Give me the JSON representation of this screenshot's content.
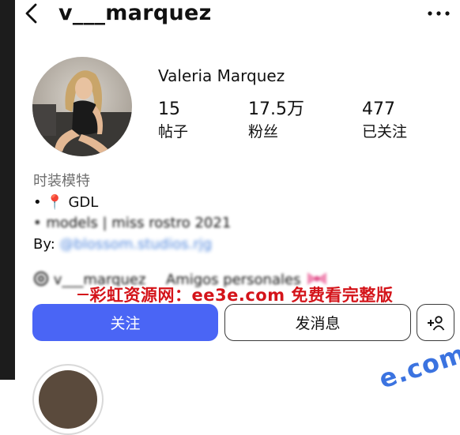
{
  "header": {
    "username": "v___marquez"
  },
  "profile": {
    "display_name": "Valeria Marquez",
    "stats": [
      {
        "value": "15",
        "label": "帖子"
      },
      {
        "value": "17.5万",
        "label": "粉丝"
      },
      {
        "value": "477",
        "label": "已关注"
      }
    ]
  },
  "bio": {
    "category": "时装模特",
    "line1": "• 📍 GDL",
    "line2": "• models | miss rostro 2021",
    "line3_prefix": "By: ",
    "line3_handle": "@blossom.studios.rjg"
  },
  "links": {
    "threads_handle": "v___marquez",
    "close_friends": "Amigos personales"
  },
  "watermark": {
    "text": "彩虹资源网：ee3e.com 免费看完整版",
    "corner": "e.com"
  },
  "actions": {
    "follow_label": "关注",
    "message_label": "发消息"
  },
  "colors": {
    "follow_button": "#4a65f5",
    "watermark": "#d4141a",
    "category_text": "#6e6e6e"
  },
  "icons": {
    "back": "chevron-left-icon",
    "more": "more-horizontal-icon",
    "threads": "threads-at-icon",
    "suggest": "add-person-icon",
    "bow": "pink-bow-icon"
  }
}
